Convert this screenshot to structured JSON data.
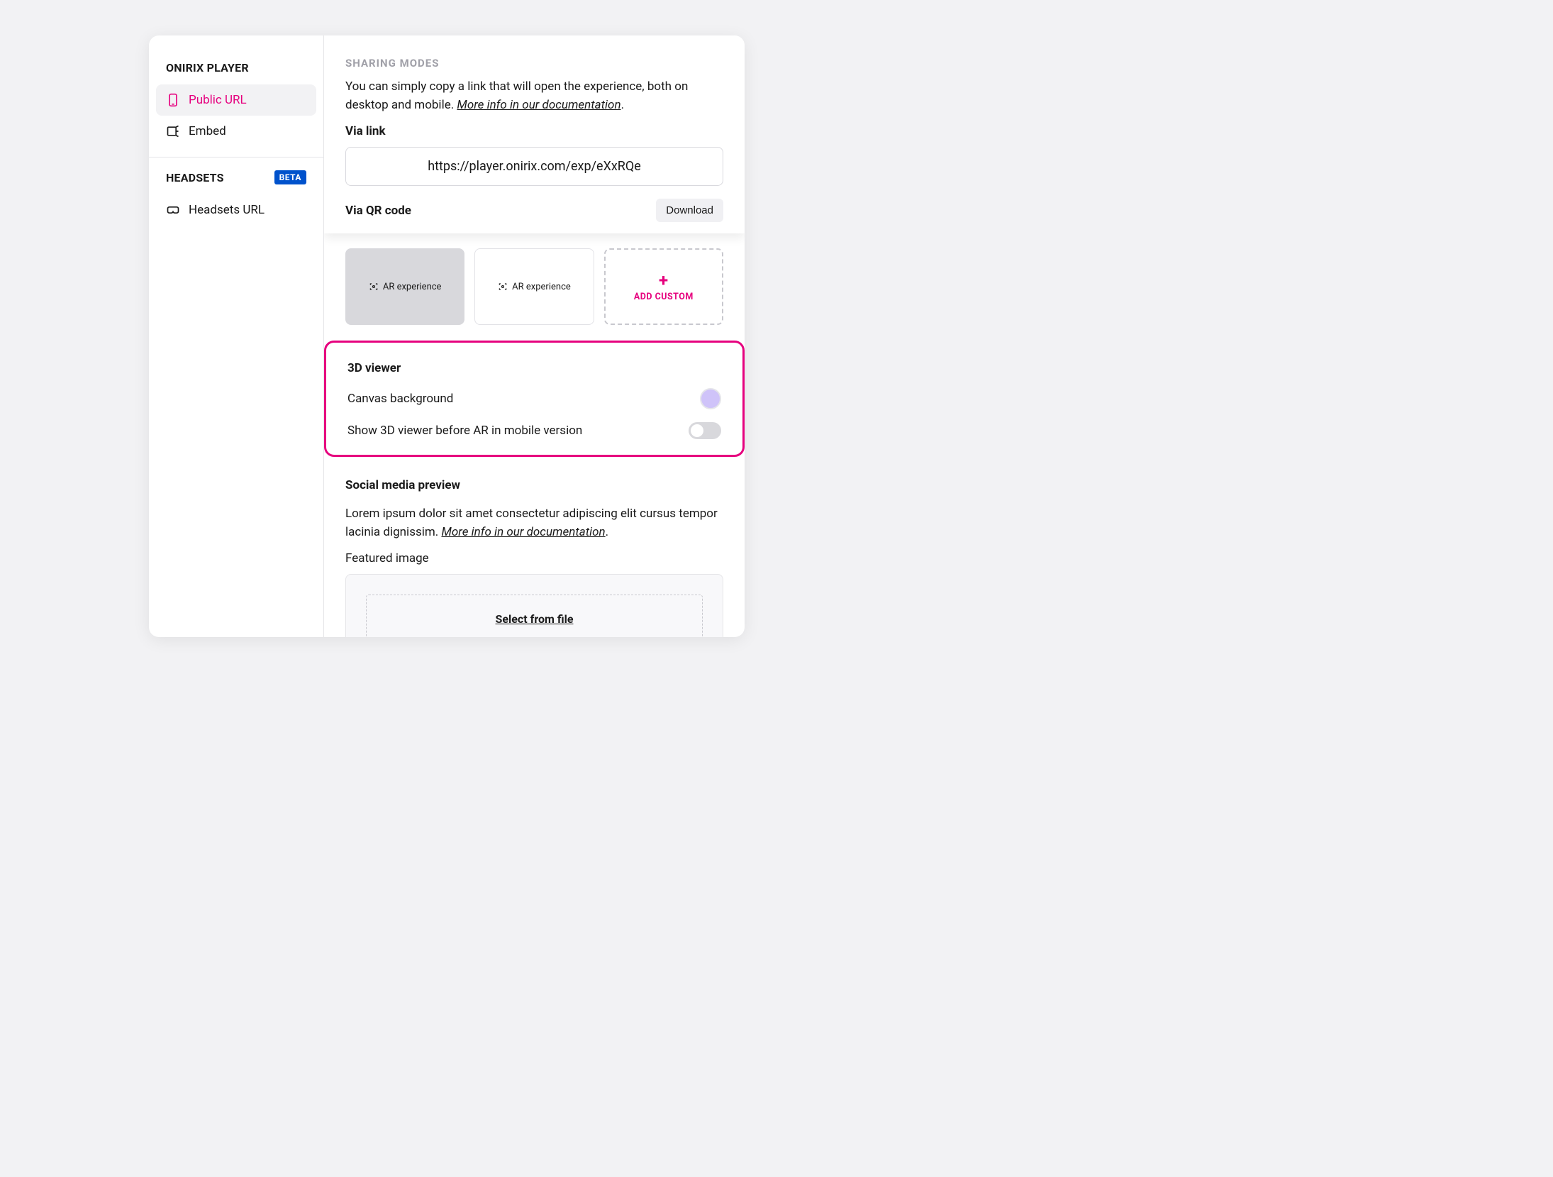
{
  "sidebar": {
    "section1_title": "ONIRIX PLAYER",
    "items1": [
      {
        "label": "Public URL"
      },
      {
        "label": "Embed"
      }
    ],
    "section2_title": "HEADSETS",
    "section2_badge": "BETA",
    "items2": [
      {
        "label": "Headsets URL"
      }
    ]
  },
  "sharing": {
    "eyebrow": "SHARING MODES",
    "description_1": "You can simply copy a link that will open the experience, both on desktop and mobile. ",
    "doc_link": "More info in our documentation",
    "description_suffix": ".",
    "via_link_label": "Via link",
    "url_value": "https://player.onirix.com/exp/eXxRQe",
    "via_qr_label": "Via QR code",
    "download_label": "Download"
  },
  "experiences": {
    "card1": "AR experience",
    "card2": "AR experience",
    "add_custom": "ADD CUSTOM"
  },
  "viewer": {
    "title": "3D viewer",
    "row1_label": "Canvas background",
    "row1_color": "#cfc3f9",
    "row2_label": "Show 3D viewer before AR in mobile version",
    "row2_on": false
  },
  "social": {
    "title": "Social media preview",
    "description_1": "Lorem ipsum dolor sit amet consectetur adipiscing elit cursus tempor lacinia dignissim. ",
    "doc_link": "More info in our documentation",
    "description_suffix": ".",
    "featured_label": "Featured image",
    "select_label": "Select from file"
  }
}
